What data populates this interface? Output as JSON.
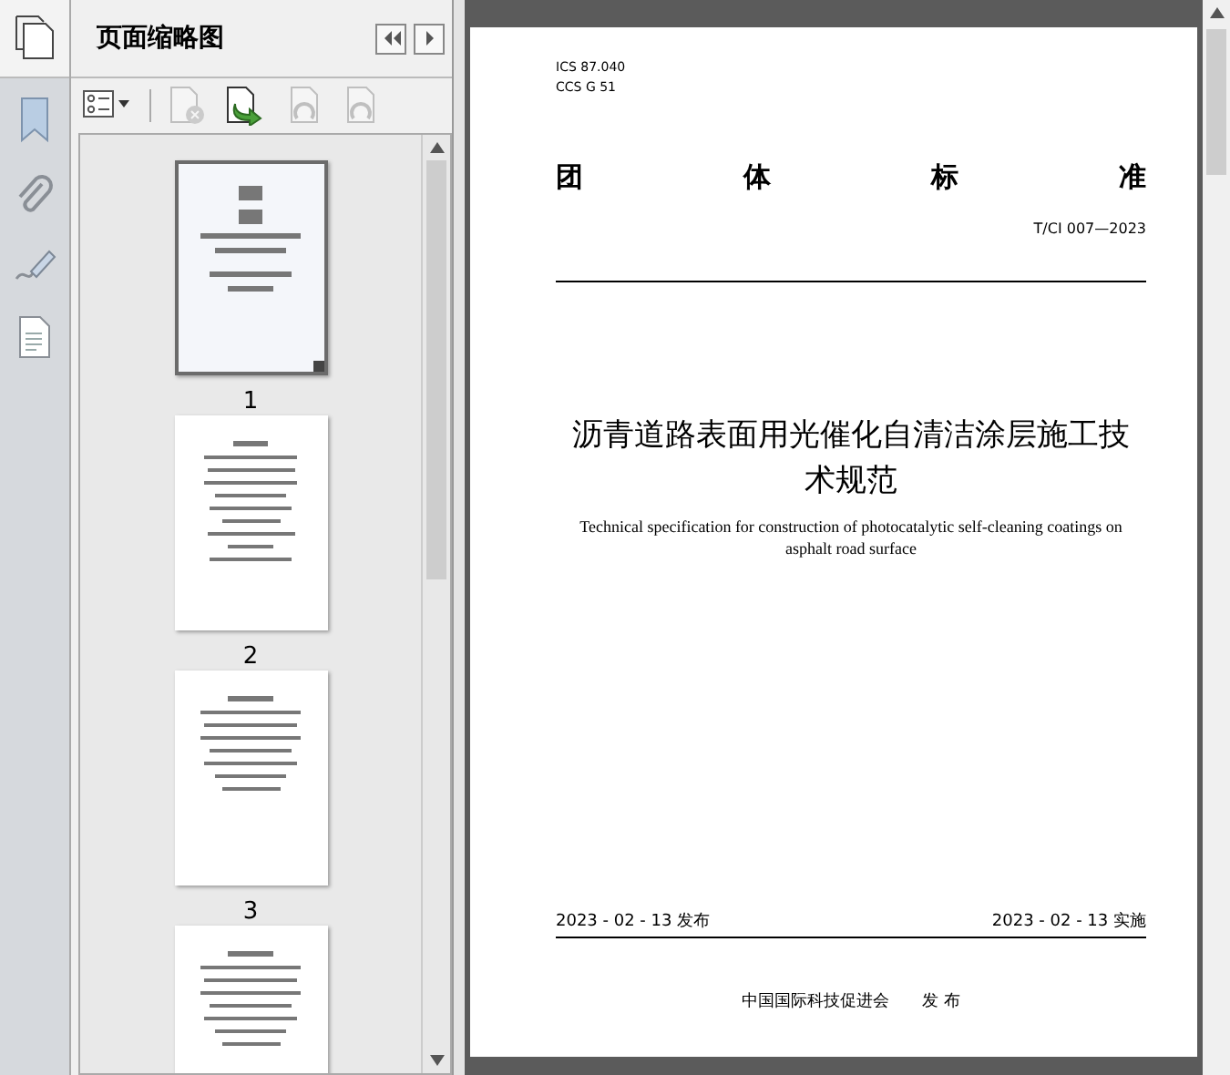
{
  "panel": {
    "title": "页面缩略图"
  },
  "side_tools": [
    {
      "kind": "bookmark"
    },
    {
      "kind": "attachment"
    },
    {
      "kind": "signature"
    },
    {
      "kind": "page"
    }
  ],
  "toolbar": [
    {
      "kind": "options",
      "disabled": false
    },
    {
      "kind": "delete",
      "disabled": true
    },
    {
      "kind": "insert",
      "disabled": false
    },
    {
      "kind": "rotate-left",
      "disabled": true
    },
    {
      "kind": "rotate-right",
      "disabled": true
    }
  ],
  "thumbnails": [
    {
      "label": "1",
      "kind": "cover",
      "selected": true
    },
    {
      "label": "2",
      "kind": "contents",
      "selected": false
    },
    {
      "label": "3",
      "kind": "text",
      "selected": false
    },
    {
      "kind": "text",
      "selected": false
    }
  ],
  "document": {
    "codes": [
      "ICS  87.040",
      "CCS  G 51"
    ],
    "heading_chars": [
      "团",
      "体",
      "标",
      "准"
    ],
    "number": "T/CI 007—2023",
    "title": "沥青道路表面用光催化自清洁涂层施工技术规范",
    "subtitle": "Technical specification for construction of photocatalytic self-cleaning coatings on asphalt road surface",
    "issue_date": "2023 - 02 - 13 发布",
    "effective_date": "2023 - 02 - 13 实施",
    "issuer": "中国国际科技促进会",
    "issuer_action": "发 布"
  }
}
